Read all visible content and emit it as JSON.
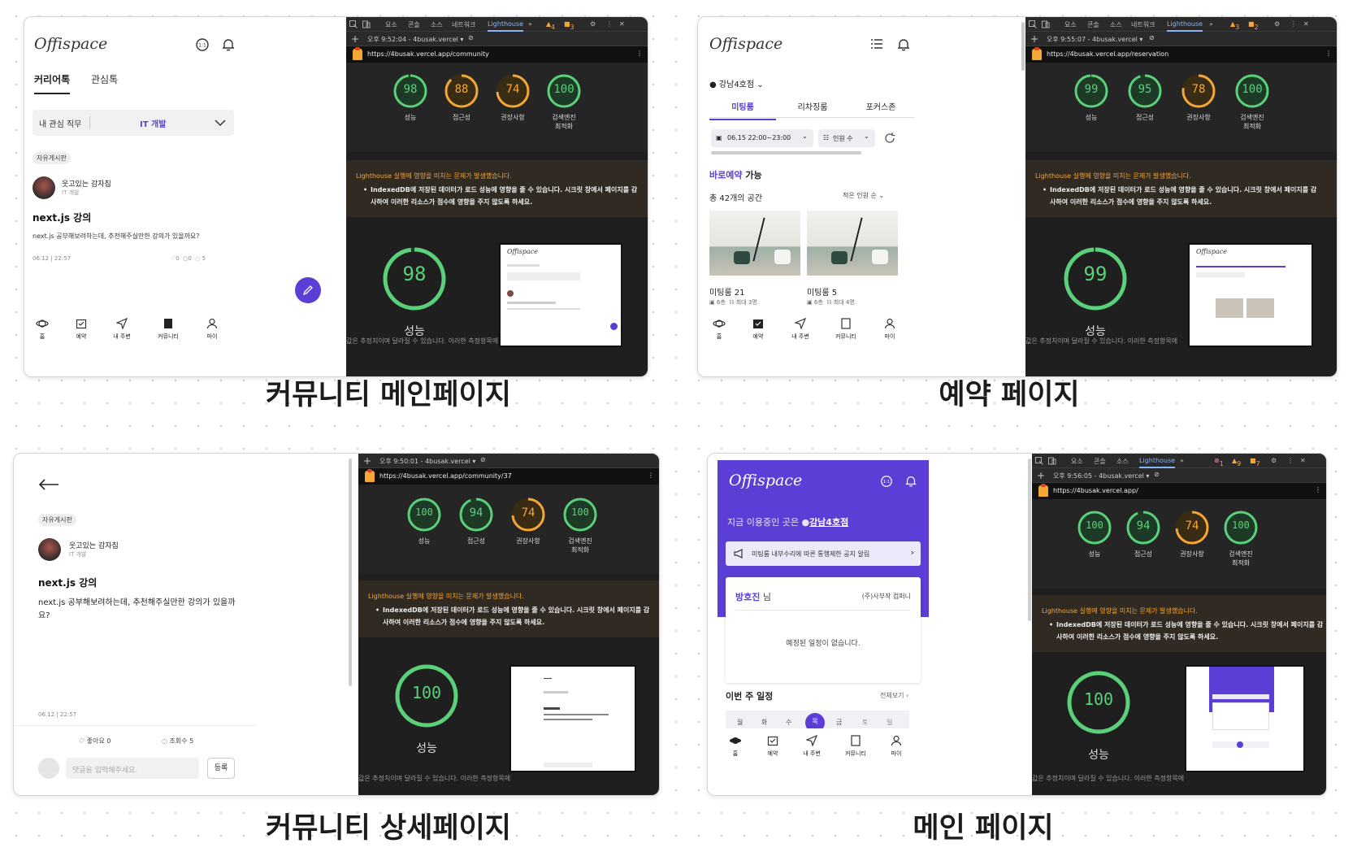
{
  "colors": {
    "accent": "#5b3ed6",
    "good": "#5ad07a",
    "mid": "#f4a734",
    "devtools_bg": "#1f1f1f"
  },
  "devtools": {
    "tabs": [
      "요소",
      "콘솔",
      "소스",
      "네트워크",
      "Lighthouse"
    ],
    "url_community": "https://4busak.vercel.app/community",
    "url_reservation": "https://4busak.vercel.app/reservation",
    "url_detail": "https://4busak.vercel.app/community/37",
    "url_main": "https://4busak.vercel.app/",
    "time_community": "오후 9:52:04 - 4busak.vercel ▾",
    "time_reservation": "오후 9:55:07 - 4busak.vercel ▾",
    "time_detail": "오후 9:50:01 - 4busak.vercel ▾",
    "time_main": "오후 9:56:05 - 4busak.vercel ▾",
    "label_perf": "성능",
    "label_a11y": "접근성",
    "label_bp": "권장사항",
    "label_seo": "검색엔진 최적화",
    "seo_l1": "검색엔진",
    "seo_l2": "최적화",
    "warn_title": "Lighthouse 실행에 영향을 미치는 문제가 발생했습니다.",
    "warn_line1": "IndexedDB에 저장된 데이터가 로드 성능에 영향을 줄 수 있습니다. 시크릿 창에서 페이지를 감",
    "warn_line2": "사하여 이러한 리소스가 점수에 영향을 주지 않도록 하세요.",
    "footer_text": "값은 추정치이며 달라질 수 있습니다. 이러한 측정항목에",
    "badges_community": {
      "warn": "4",
      "issue": "3"
    },
    "badges_reservation": {
      "warn": "3",
      "issue": "2"
    },
    "badges_main": {
      "error": "1",
      "warn": "9",
      "issue": "7"
    }
  },
  "panels": [
    {
      "caption": "커뮤니티 메인페이지",
      "scores": {
        "performance": 98,
        "accessibility": 88,
        "best_practices": 74,
        "seo": 100
      }
    },
    {
      "caption": "예약 페이지",
      "scores": {
        "performance": 99,
        "accessibility": 95,
        "best_practices": 78,
        "seo": 100
      }
    },
    {
      "caption": "커뮤니티 상세페이지",
      "scores": {
        "performance": 100,
        "accessibility": 94,
        "best_practices": 74,
        "seo": 100
      }
    },
    {
      "caption": "메인 페이지",
      "scores": {
        "performance": 100,
        "accessibility": 94,
        "best_practices": 74,
        "seo": 100
      }
    }
  ],
  "nav": {
    "home": "홈",
    "reserve": "예약",
    "nearby": "내 주변",
    "community": "커뮤니티",
    "my": "마이"
  },
  "community": {
    "logo": "Offispace",
    "tab_career": "커리어톡",
    "tab_interest": "관심톡",
    "job_label": "내 관심 직무",
    "job_value": "IT 개발",
    "board_tag": "자유게시판",
    "author": "웃고있는 감자칩",
    "author_job": "IT 개발",
    "post_title": "next.js 강의",
    "post_body": "next.js 공부해보려하는데, 추천해주실만한 강의가 있을까요?",
    "date": "06.12",
    "time": "22:57",
    "likes": "0",
    "comments": "0",
    "views": "5"
  },
  "reservation": {
    "branch": "강남4호점",
    "tabs": [
      "미팅룸",
      "리차징룸",
      "포커스존"
    ],
    "date_filter": "06.15 22:00~23:00",
    "people_filter": "인원 수",
    "available_link": "바로예약",
    "available_suffix": "가능",
    "total": "총 42개의 공간",
    "sort": "적은 인원 순",
    "rooms": [
      {
        "name": "미팅룸 21",
        "floor": "6층",
        "capacity": "최대 3명"
      },
      {
        "name": "미팅룸 5",
        "floor": "6층",
        "capacity": "최대 4명"
      }
    ]
  },
  "detail": {
    "board_tag": "자유게시판",
    "author": "웃고있는 감자칩",
    "author_job": "IT 개발",
    "title": "next.js 강의",
    "body_l1": "next.js 공부해보려하는데, 추천해주실만한 강의가 있을까",
    "body_l2": "요?",
    "date": "06.12",
    "time": "22:57",
    "likes_label": "좋아요 0",
    "views_label": "조회수 5",
    "comment_placeholder": "댓글을 입력해주세요.",
    "submit": "등록"
  },
  "main": {
    "logo": "Offispace",
    "current_label": "지금 이용중인 곳은",
    "current_branch": "강남4호점",
    "notice": "미팅룸 내부수리에 따른 통행제한 공지 알림",
    "user_name": "방호진",
    "user_suffix": "님",
    "company": "(주)사부작 컴퍼니",
    "no_schedule": "예정된 일정이 없습니다.",
    "week_title": "이번 주 일정",
    "view_all": "전체보기",
    "days": [
      "월",
      "화",
      "수",
      "목",
      "금",
      "토",
      "일"
    ]
  }
}
